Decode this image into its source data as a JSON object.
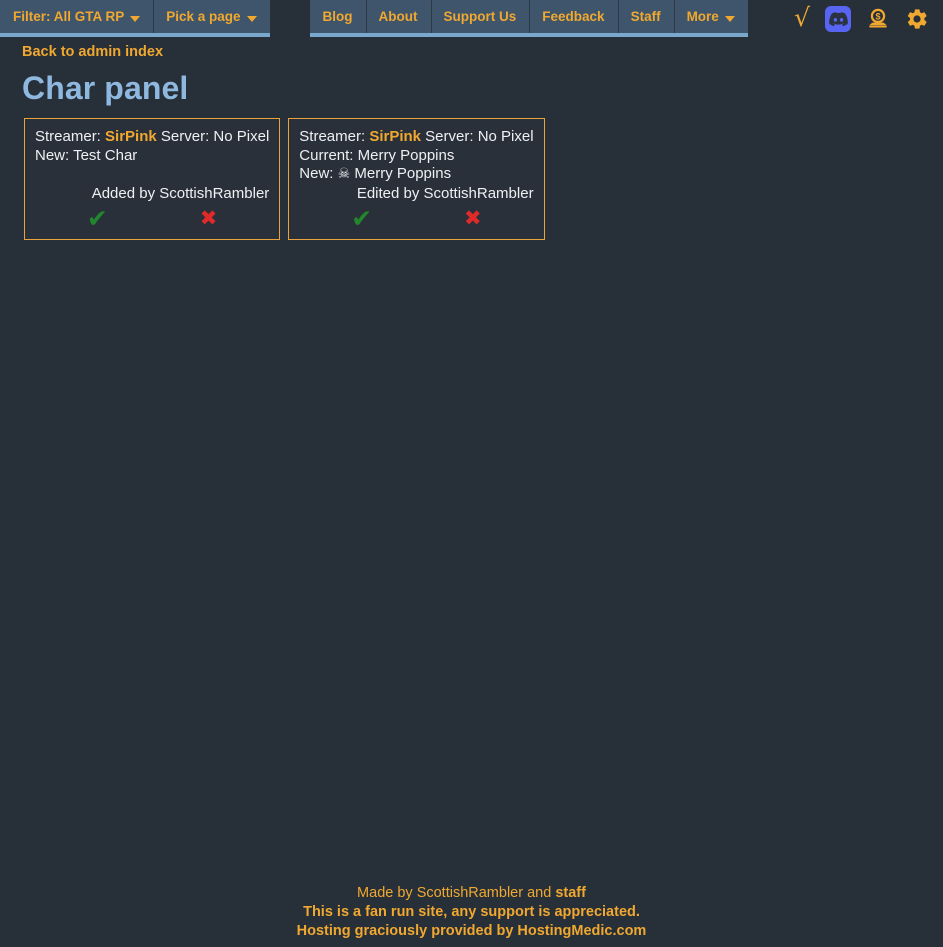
{
  "navbar": {
    "left_tabs": [
      {
        "label": "Filter: All GTA RP",
        "caret": true,
        "name": "nav-filter"
      },
      {
        "label": "Pick a page",
        "caret": true,
        "name": "nav-pick-a-page"
      }
    ],
    "main_tabs": [
      {
        "label": "Blog",
        "caret": false,
        "name": "nav-blog"
      },
      {
        "label": "About",
        "caret": false,
        "name": "nav-about"
      },
      {
        "label": "Support Us",
        "caret": false,
        "name": "nav-support-us"
      },
      {
        "label": "Feedback",
        "caret": false,
        "name": "nav-feedback"
      },
      {
        "label": "Staff",
        "caret": false,
        "name": "nav-staff"
      },
      {
        "label": "More",
        "caret": true,
        "name": "nav-more"
      }
    ],
    "icons": [
      {
        "name": "square-root-icon",
        "glyph": "√"
      },
      {
        "name": "discord-icon",
        "glyph": ""
      },
      {
        "name": "donate-money-icon",
        "glyph": ""
      },
      {
        "name": "settings-gear-icon",
        "glyph": ""
      }
    ],
    "colors": {
      "tab_bg": "#3e556b",
      "tab_underline": "#7aa7cc",
      "tab_text": "#f0a830",
      "page_bg": "#272f38"
    }
  },
  "page": {
    "back_link": "Back to admin index",
    "title": "Char panel",
    "title_color": "#8fb8e0"
  },
  "cards": [
    {
      "streamer_label": "Streamer:",
      "streamer_name": "SirPink",
      "server_label": "Server:",
      "server_name": "No Pixel",
      "rows": [
        {
          "label": "New:",
          "value": "Test Char",
          "skull": false
        }
      ],
      "by_line": "Added by ScottishRambler",
      "approve_icon": "✔",
      "deny_icon": "✖"
    },
    {
      "streamer_label": "Streamer:",
      "streamer_name": "SirPink",
      "server_label": "Server:",
      "server_name": "No Pixel",
      "rows": [
        {
          "label": "Current:",
          "value": "Merry Poppins",
          "skull": false
        },
        {
          "label": "New:",
          "value": "Merry Poppins",
          "skull": true,
          "skull_glyph": "☠"
        }
      ],
      "by_line": "Edited by ScottishRambler",
      "approve_icon": "✔",
      "deny_icon": "✖"
    }
  ],
  "footer": {
    "line1_prefix": "Made by ScottishRambler and ",
    "line1_link": "staff",
    "line2": "This is a fan run site, any support is appreciated.",
    "line3": "Hosting graciously provided by HostingMedic.com",
    "color": "#f0a830"
  }
}
